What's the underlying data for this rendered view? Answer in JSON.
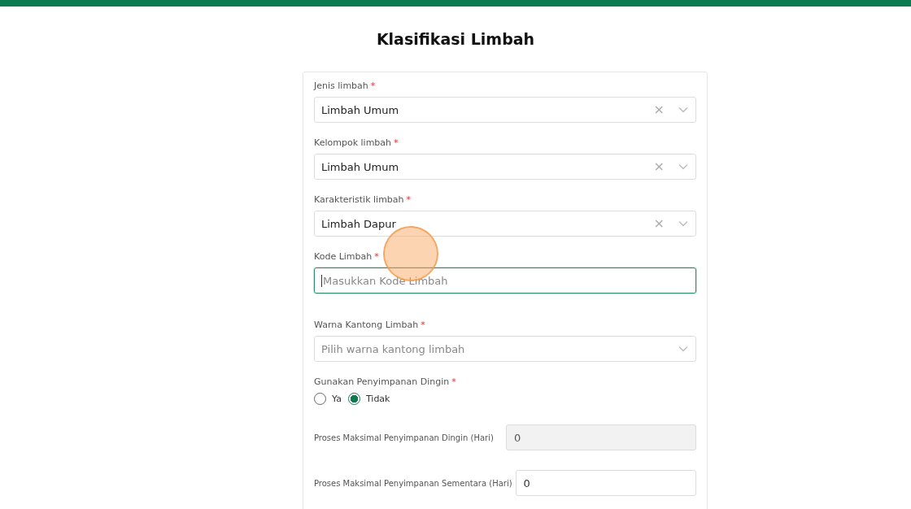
{
  "header": {
    "title": "Klasifikasi Limbah"
  },
  "fields": [
    {
      "kind": "select",
      "label": "Jenis limbah",
      "required_mark": "*",
      "value": "Limbah Umum",
      "clear_icon": "×"
    },
    {
      "kind": "select",
      "label": "Kelompok limbah",
      "required_mark": "*",
      "value": "Limbah Umum",
      "clear_icon": "×"
    },
    {
      "kind": "select",
      "label": "Karakteristik limbah",
      "required_mark": "*",
      "value": "Limbah Dapur",
      "clear_icon": "×"
    },
    {
      "kind": "text",
      "label": "Kode Limbah",
      "required_mark": "*",
      "placeholder": "Masukkan Kode Limbah",
      "focused": true
    },
    {
      "kind": "select",
      "label": "Warna Kantong Limbah",
      "required_mark": "*",
      "placeholder": "Pilih warna kantong limbah"
    },
    {
      "kind": "radio",
      "label": "Gunakan Penyimpanan Dingin",
      "required_mark": "*",
      "options": [
        {
          "label": "Ya",
          "selected": false
        },
        {
          "label": "Tidak",
          "selected": true
        }
      ]
    },
    {
      "kind": "inline",
      "label": "Proses Maksimal Penyimpanan Dingin (Hari)",
      "value": "0",
      "disabled": true
    },
    {
      "kind": "inline",
      "label": "Proses Maksimal Penyimpanan Sementara (Hari)",
      "value": "0",
      "disabled": false
    }
  ]
}
